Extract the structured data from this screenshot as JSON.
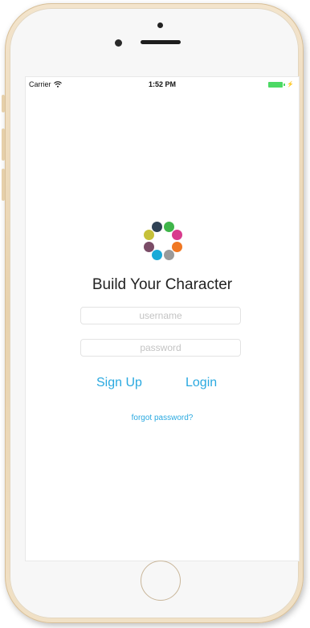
{
  "status_bar": {
    "carrier": "Carrier",
    "time": "1:52 PM",
    "battery_color": "#4cd964"
  },
  "logo": {
    "icon": "color-dots-ring-icon",
    "colors": [
      "#3fb54a",
      "#d83b8d",
      "#f07722",
      "#9a9a9a",
      "#1aaad8",
      "#7a4c67",
      "#c6c13a",
      "#2f4255"
    ]
  },
  "app": {
    "title": "Build Your Character",
    "username_placeholder": "username",
    "password_placeholder": "password",
    "signup_label": "Sign Up",
    "login_label": "Login",
    "forgot_label": "forgot password?",
    "accent_color": "#2aa9e0"
  }
}
